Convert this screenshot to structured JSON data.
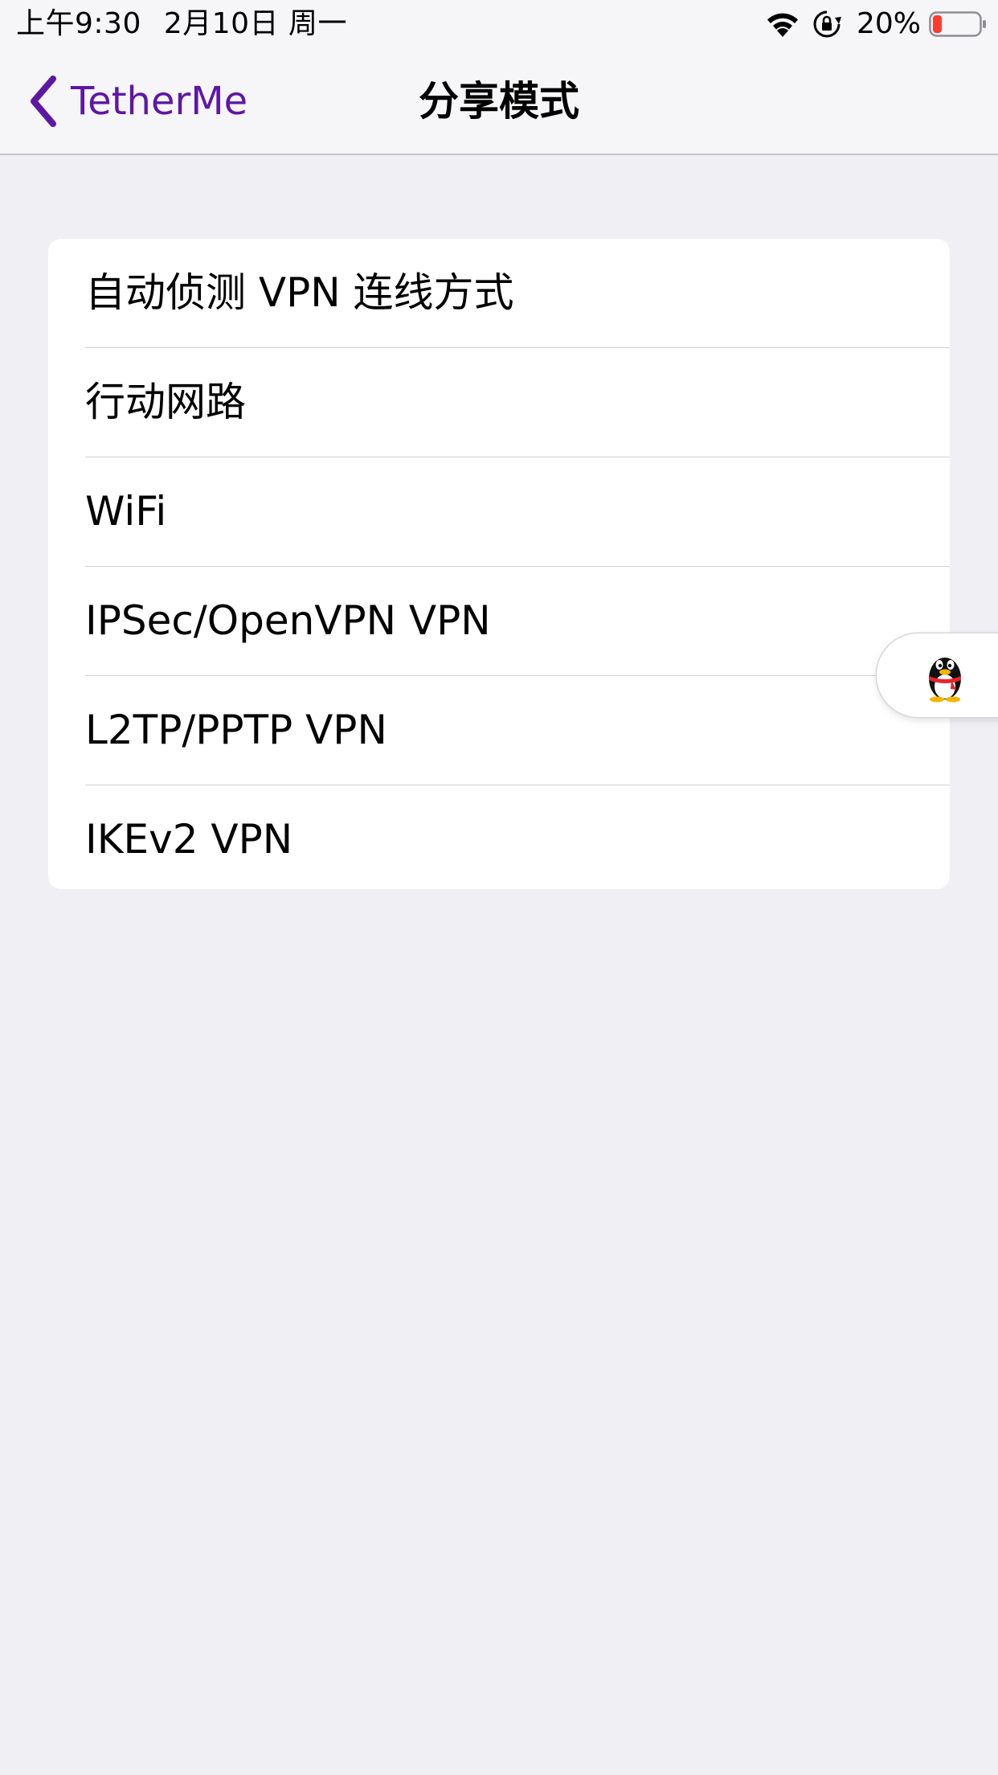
{
  "status_bar": {
    "time": "上午9:30",
    "date": "2月10日 周一",
    "battery_percent": "20%",
    "battery_level": 0.2,
    "icons": [
      "wifi-icon",
      "orientation-lock-icon",
      "battery-icon"
    ]
  },
  "nav": {
    "back_label": "TetherMe",
    "title": "分享模式",
    "back_icon": "chevron-left-icon"
  },
  "options": [
    {
      "label": "自动侦测 VPN 连线方式"
    },
    {
      "label": "行动网路"
    },
    {
      "label": "WiFi"
    },
    {
      "label": "IPSec/OpenVPN VPN"
    },
    {
      "label": "L2TP/PPTP VPN"
    },
    {
      "label": "IKEv2 VPN"
    }
  ],
  "floating_button": {
    "icon": "qq-penguin-icon"
  },
  "colors": {
    "accent": "#5e17a5",
    "background": "#efeff4",
    "cell": "#ffffff",
    "separator": "#d1d1d6",
    "battery_low": "#ff3b30"
  }
}
